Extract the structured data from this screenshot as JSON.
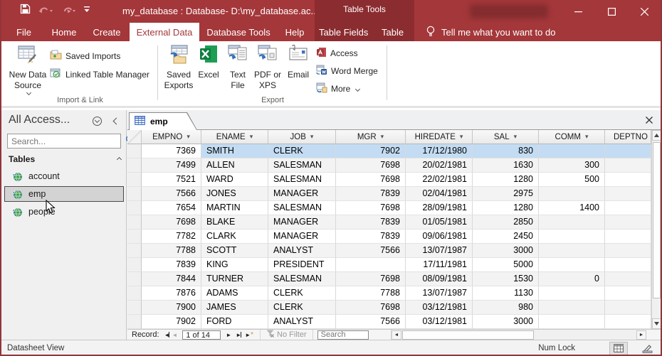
{
  "window": {
    "title": "my_database : Database- D:\\my_database.ac...",
    "contextual_tool": "Table Tools"
  },
  "tabs": {
    "file": "File",
    "main": [
      "Home",
      "Create",
      "External Data",
      "Database Tools",
      "Help"
    ],
    "selected": "External Data",
    "contextual": [
      "Table Fields",
      "Table"
    ],
    "tell_me": "Tell me what you want to do"
  },
  "ribbon": {
    "new_data_source": "New Data Source",
    "saved_imports": "Saved Imports",
    "linked_table_manager": "Linked Table Manager",
    "group1_label": "Import & Link",
    "saved_exports": "Saved Exports",
    "excel": "Excel",
    "text_file": "Text File",
    "pdf_or_xps": "PDF or XPS",
    "email": "Email",
    "access": "Access",
    "word_merge": "Word Merge",
    "more": "More",
    "group2_label": "Export"
  },
  "sidebar": {
    "title": "All Access...",
    "search_placeholder": "Search...",
    "group": "Tables",
    "items": [
      {
        "label": "account",
        "selected": false
      },
      {
        "label": "emp",
        "selected": true
      },
      {
        "label": "people",
        "selected": false
      }
    ]
  },
  "document": {
    "tab": "emp",
    "columns": [
      "EMPNO",
      "ENAME",
      "JOB",
      "MGR",
      "HIREDATE",
      "SAL",
      "COMM",
      "DEPTNO"
    ],
    "rows": [
      [
        "7369",
        "SMITH",
        "CLERK",
        "7902",
        "17/12/1980",
        "830",
        "",
        ""
      ],
      [
        "7499",
        "ALLEN",
        "SALESMAN",
        "7698",
        "20/02/1981",
        "1630",
        "300",
        ""
      ],
      [
        "7521",
        "WARD",
        "SALESMAN",
        "7698",
        "22/02/1981",
        "1280",
        "500",
        ""
      ],
      [
        "7566",
        "JONES",
        "MANAGER",
        "7839",
        "02/04/1981",
        "2975",
        "",
        ""
      ],
      [
        "7654",
        "MARTIN",
        "SALESMAN",
        "7698",
        "28/09/1981",
        "1280",
        "1400",
        ""
      ],
      [
        "7698",
        "BLAKE",
        "MANAGER",
        "7839",
        "01/05/1981",
        "2850",
        "",
        ""
      ],
      [
        "7782",
        "CLARK",
        "MANAGER",
        "7839",
        "09/06/1981",
        "2450",
        "",
        ""
      ],
      [
        "7788",
        "SCOTT",
        "ANALYST",
        "7566",
        "13/07/1987",
        "3000",
        "",
        ""
      ],
      [
        "7839",
        "KING",
        "PRESIDENT",
        "",
        "17/11/1981",
        "5000",
        "",
        ""
      ],
      [
        "7844",
        "TURNER",
        "SALESMAN",
        "7698",
        "08/09/1981",
        "1530",
        "0",
        ""
      ],
      [
        "7876",
        "ADAMS",
        "CLERK",
        "7788",
        "13/07/1987",
        "1130",
        "",
        ""
      ],
      [
        "7900",
        "JAMES",
        "CLERK",
        "7698",
        "03/12/1981",
        "980",
        "",
        ""
      ],
      [
        "7902",
        "FORD",
        "ANALYST",
        "7566",
        "03/12/1981",
        "3000",
        "",
        ""
      ]
    ]
  },
  "record_nav": {
    "label": "Record:",
    "position": "1 of 14",
    "no_filter": "No Filter",
    "search_placeholder": "Search"
  },
  "status_bar": {
    "left": "Datasheet View",
    "right": "Num Lock"
  },
  "colors": {
    "accent_red": "#a4373a",
    "contextual_red": "#8b2c30",
    "selected_row": "#c3dcf3",
    "excel_green": "#107c41",
    "word_blue": "#2b579a"
  }
}
